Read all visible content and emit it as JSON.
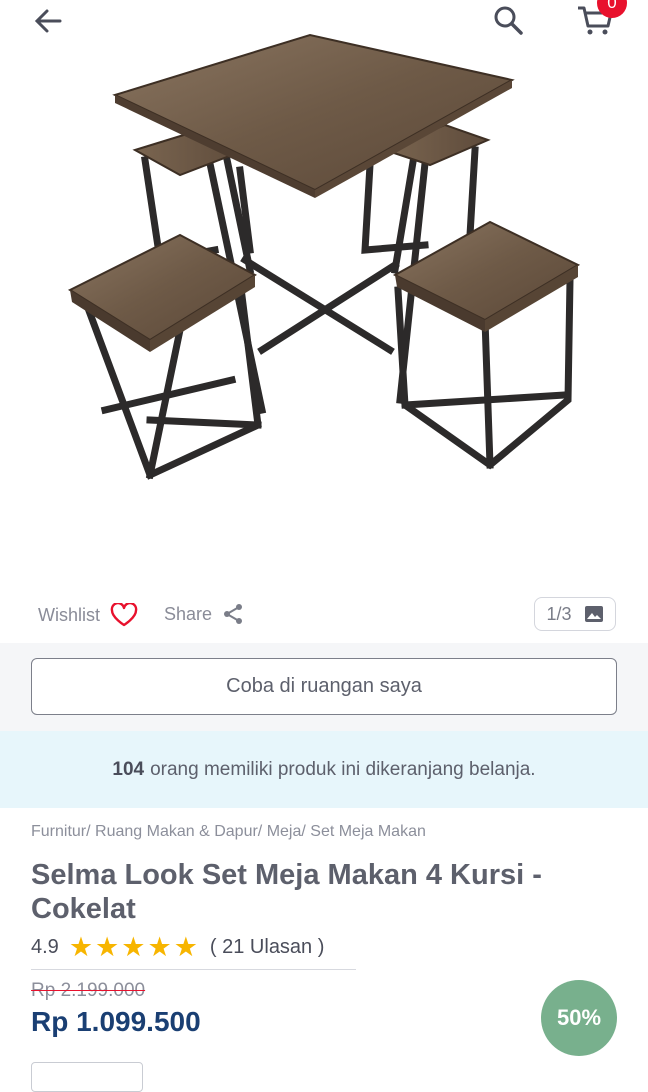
{
  "header": {
    "cart_count": "0"
  },
  "gallery": {
    "wishlist_label": "Wishlist",
    "share_label": "Share",
    "counter": "1/3"
  },
  "try_in_room": {
    "label": "Coba di ruangan saya"
  },
  "cart_notice": {
    "count": "104",
    "text": "orang memiliki produk ini dikeranjang belanja."
  },
  "breadcrumb": [
    "Furnitur/",
    "Ruang Makan & Dapur/",
    "Meja/",
    "Set Meja Makan"
  ],
  "product": {
    "title": "Selma Look Set Meja Makan 4 Kursi - Cokelat",
    "rating": "4.9",
    "stars": 5,
    "reviews": "( 21 Ulasan )",
    "old_price": "Rp 2.199.000",
    "price": "Rp 1.099.500",
    "discount": "50%"
  },
  "colors": {
    "price": "#1a3f73",
    "star": "#f7b500",
    "badge": "#e8112d",
    "discount": "#78b08d"
  }
}
